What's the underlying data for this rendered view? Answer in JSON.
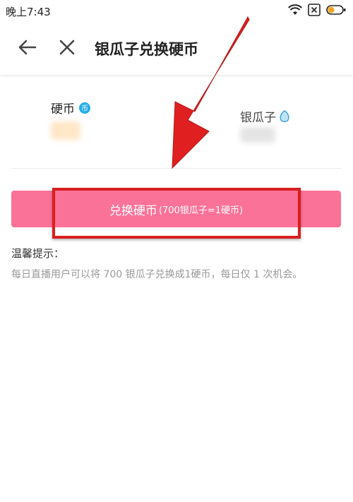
{
  "status_bar": {
    "time": "晚上7:43",
    "icons": [
      "wifi-icon",
      "sim-x-icon",
      "battery-icon"
    ],
    "battery_color": "#f5a623"
  },
  "header": {
    "title": "银瓜子兑换硬币",
    "icons": [
      "back-arrow-icon",
      "close-icon"
    ]
  },
  "balances": {
    "coin_label": "硬币",
    "coin_badge": "币",
    "coin_value": "",
    "silver_label": "银瓜子",
    "silver_value": ""
  },
  "exchange": {
    "label": "兑换硬币",
    "rate": "(700银瓜子=1硬币)",
    "color": "#fb7299"
  },
  "tips": {
    "title": "温馨提示：",
    "text": "每日直播用户可以将 700 银瓜子兑换成1硬币，每日仅 1 次机会。"
  },
  "annotation": {
    "color": "#e02020"
  }
}
